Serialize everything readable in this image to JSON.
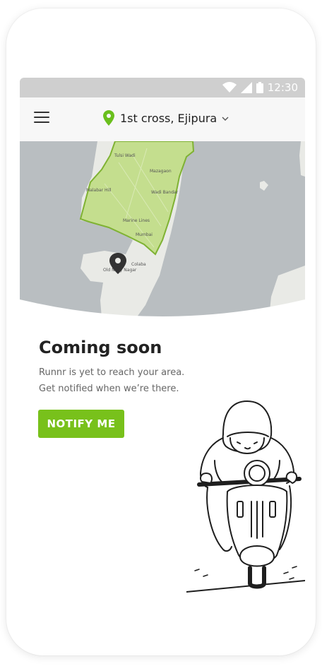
{
  "status_bar": {
    "time": "12:30"
  },
  "header": {
    "location": "1st cross, Ejipura"
  },
  "map": {
    "labels": [
      "Tulsi Wadi",
      "Mazagaon",
      "Malabar Hill",
      "Wadi Bandar",
      "Marine Lines",
      "Mumbai",
      "Colaba",
      "Old Navy Nagar"
    ],
    "colors": {
      "water": "#b9bec1",
      "land": "#e9eae6",
      "zone": "#c4de8e",
      "zone_border": "#7fb233"
    }
  },
  "content": {
    "title": "Coming soon",
    "line1": "Runnr is yet to reach your area.",
    "line2": "Get notified when we’re there.",
    "button": "NOTIFY ME"
  },
  "colors": {
    "accent": "#78c11b",
    "pin": "#6abf1d"
  }
}
